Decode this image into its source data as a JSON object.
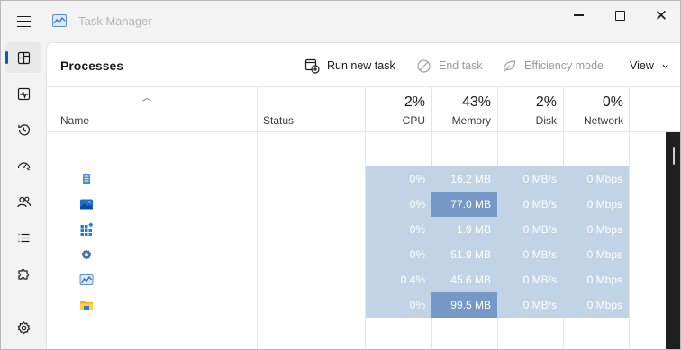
{
  "window": {
    "title": "Task Manager"
  },
  "nav": {
    "items": [
      {
        "name": "processes",
        "icon": "processes-icon",
        "active": true
      },
      {
        "name": "performance",
        "icon": "performance-icon",
        "active": false
      },
      {
        "name": "app-history",
        "icon": "history-icon",
        "active": false
      },
      {
        "name": "startup-apps",
        "icon": "speedometer-icon",
        "active": false
      },
      {
        "name": "users",
        "icon": "users-icon",
        "active": false
      },
      {
        "name": "details",
        "icon": "list-icon",
        "active": false
      },
      {
        "name": "services",
        "icon": "puzzle-icon",
        "active": false
      },
      {
        "name": "settings",
        "icon": "gear-icon",
        "active": false
      }
    ]
  },
  "toolbar": {
    "page_title": "Processes",
    "run_new_task": "Run new task",
    "end_task": "End task",
    "efficiency_mode": "Efficiency mode",
    "view": "View"
  },
  "table": {
    "headers": {
      "name": "Name",
      "status": "Status",
      "cpu": {
        "pct": "2%",
        "label": "CPU"
      },
      "memory": {
        "pct": "43%",
        "label": "Memory"
      },
      "disk": {
        "pct": "2%",
        "label": "Disk"
      },
      "network": {
        "pct": "0%",
        "label": "Network"
      }
    },
    "rows": [
      {
        "icon": "notepad-icon",
        "cpu": "0%",
        "memory": "16.2 MB",
        "disk": "0 MB/s",
        "network": "0 Mbps",
        "mem_hot": false
      },
      {
        "icon": "photos-icon",
        "cpu": "0%",
        "memory": "77.0 MB",
        "disk": "0 MB/s",
        "network": "0 Mbps",
        "mem_hot": true
      },
      {
        "icon": "store-icon",
        "cpu": "0%",
        "memory": "1.9 MB",
        "disk": "0 MB/s",
        "network": "0 Mbps",
        "mem_hot": false
      },
      {
        "icon": "settings-app-icon",
        "cpu": "0%",
        "memory": "51.9 MB",
        "disk": "0 MB/s",
        "network": "0 Mbps",
        "mem_hot": false
      },
      {
        "icon": "task-manager-icon",
        "cpu": "0.4%",
        "memory": "45.6 MB",
        "disk": "0 MB/s",
        "network": "0 Mbps",
        "mem_hot": false
      },
      {
        "icon": "file-explorer-icon",
        "cpu": "0%",
        "memory": "99.5 MB",
        "disk": "0 MB/s",
        "network": "0 Mbps",
        "mem_hot": true
      }
    ]
  },
  "colors": {
    "accent": "#005fb8",
    "cell_light": "#c2d3e6",
    "cell_hot": "#7698c6"
  }
}
